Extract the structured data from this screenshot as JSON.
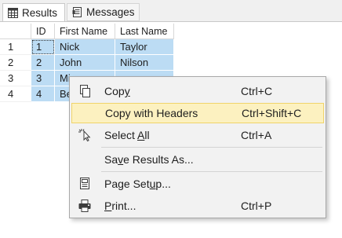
{
  "tabs": [
    {
      "label": "Results",
      "icon": "grid-icon",
      "active": true
    },
    {
      "label": "Messages",
      "icon": "messages-icon",
      "active": false
    }
  ],
  "grid": {
    "columns": [
      "ID",
      "First Name",
      "Last Name"
    ],
    "rows": [
      {
        "rownum": "1",
        "id": "1",
        "first": "Nick",
        "last": "Taylor"
      },
      {
        "rownum": "2",
        "id": "2",
        "first": "John",
        "last": "Nilson"
      },
      {
        "rownum": "3",
        "id": "3",
        "first": "Mi",
        "last": ""
      },
      {
        "rownum": "4",
        "id": "4",
        "first": "Be",
        "last": ""
      }
    ]
  },
  "context_menu": {
    "items": [
      {
        "label": "Copy",
        "underline": "y",
        "shortcut": "Ctrl+C",
        "icon": "copy-icon"
      },
      {
        "label": "Copy with Headers",
        "underline": "",
        "shortcut": "Ctrl+Shift+C",
        "icon": "",
        "highlighted": true
      },
      {
        "label": "Select All",
        "underline": "A",
        "shortcut": "Ctrl+A",
        "icon": "select-all-icon"
      },
      {
        "label": "Save Results As...",
        "underline": "v",
        "shortcut": "",
        "icon": ""
      },
      {
        "label": "Page Setup...",
        "underline": "u",
        "shortcut": "",
        "icon": "page-setup-icon"
      },
      {
        "label": "Print...",
        "underline": "P",
        "shortcut": "Ctrl+P",
        "icon": "printer-icon"
      }
    ]
  },
  "colors": {
    "selection": "#bcdcf4",
    "menu_highlight": "#fcf1c0",
    "menu_highlight_border": "#f0d36a",
    "menu_background": "#f2f2f2"
  }
}
